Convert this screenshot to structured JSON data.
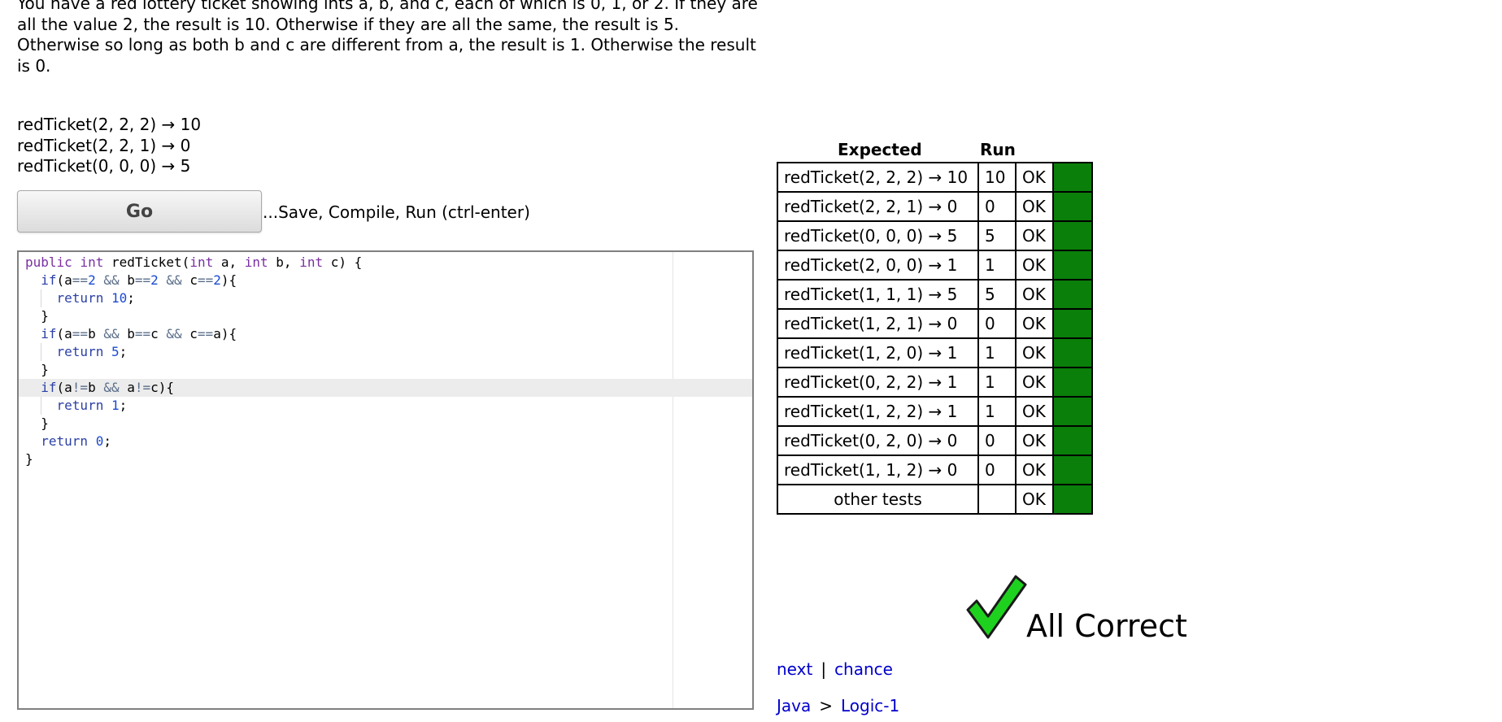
{
  "problem": {
    "description": "You have a red lottery ticket showing ints a, b, and c, each of which is 0, 1, or 2. If they are all the value 2, the result is 10. Otherwise if they are all the same, the result is 5. Otherwise so long as both b and c are different from a, the result is 1. Otherwise the result is 0.",
    "examples": [
      "redTicket(2, 2, 2) → 10",
      "redTicket(2, 2, 1) → 0",
      "redTicket(0, 0, 0) → 5"
    ]
  },
  "toolbar": {
    "go_label": "Go",
    "hint": "...Save, Compile, Run (ctrl-enter)"
  },
  "editor": {
    "lines": [
      "public int redTicket(int a, int b, int c) {",
      "  if(a==2 && b==2 && c==2){",
      "    return 10;",
      "  }",
      "  if(a==b && b==c && c==a){",
      "    return 5;",
      "  }",
      "  if(a!=b && a!=c){",
      "    return 1;",
      "  }",
      "  return 0;",
      "}"
    ],
    "active_line": 8
  },
  "results": {
    "header_expected": "Expected",
    "header_run": "Run",
    "rows": [
      {
        "expected": "redTicket(2, 2, 2) → 10",
        "run": "10",
        "status": "OK"
      },
      {
        "expected": "redTicket(2, 2, 1) → 0",
        "run": "0",
        "status": "OK"
      },
      {
        "expected": "redTicket(0, 0, 0) → 5",
        "run": "5",
        "status": "OK"
      },
      {
        "expected": "redTicket(2, 0, 0) → 1",
        "run": "1",
        "status": "OK"
      },
      {
        "expected": "redTicket(1, 1, 1) → 5",
        "run": "5",
        "status": "OK"
      },
      {
        "expected": "redTicket(1, 2, 1) → 0",
        "run": "0",
        "status": "OK"
      },
      {
        "expected": "redTicket(1, 2, 0) → 1",
        "run": "1",
        "status": "OK"
      },
      {
        "expected": "redTicket(0, 2, 2) → 1",
        "run": "1",
        "status": "OK"
      },
      {
        "expected": "redTicket(1, 2, 2) → 1",
        "run": "1",
        "status": "OK"
      },
      {
        "expected": "redTicket(0, 2, 0) → 0",
        "run": "0",
        "status": "OK"
      },
      {
        "expected": "redTicket(1, 1, 2) → 0",
        "run": "0",
        "status": "OK"
      },
      {
        "expected": "other tests",
        "run": "",
        "status": "OK"
      }
    ],
    "pass_color": "#0a7f0a"
  },
  "status": {
    "icon": "green-checkmark-icon",
    "text": "All Correct"
  },
  "nav": {
    "next": "next",
    "separator": "|",
    "chance": "chance"
  },
  "breadcrumb": {
    "items": [
      "Java",
      "Logic-1"
    ],
    "separator": ">"
  }
}
